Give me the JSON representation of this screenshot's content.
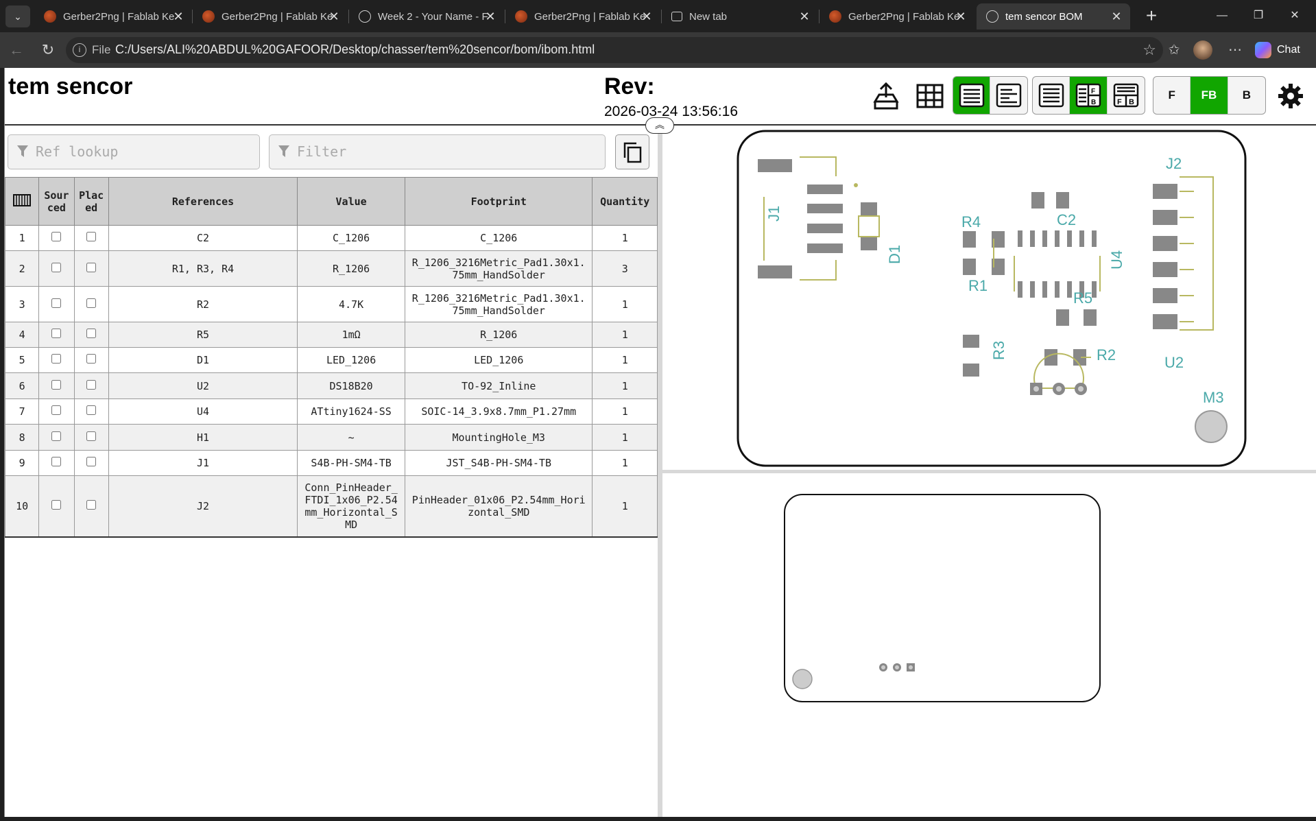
{
  "browser": {
    "tabs": [
      {
        "title": "Gerber2Png | Fablab Ke",
        "icon": "fablab"
      },
      {
        "title": "Gerber2Png | Fablab Ke",
        "icon": "fablab"
      },
      {
        "title": "Week 2 - Your Name - F",
        "icon": "globe"
      },
      {
        "title": "Gerber2Png | Fablab Ke",
        "icon": "fablab"
      },
      {
        "title": "New tab",
        "icon": "newtab"
      },
      {
        "title": "Gerber2Png | Fablab Ke",
        "icon": "fablab"
      },
      {
        "title": "tem sencor BOM",
        "icon": "globe",
        "active": true
      }
    ],
    "address": {
      "scheme_label": "File",
      "url": "C:/Users/ALI%20ABDUL%20GAFOOR/Desktop/chasser/tem%20sencor/bom/ibom.html"
    },
    "chat_label": "Chat"
  },
  "header": {
    "title": "tem sencor",
    "rev_label": "Rev:",
    "date": "2026-03-24 13:56:16",
    "layer_buttons": [
      "F",
      "FB",
      "B"
    ],
    "active_layer": "FB"
  },
  "filters": {
    "ref_placeholder": "Ref lookup",
    "filter_placeholder": "Filter"
  },
  "bom": {
    "columns": [
      "",
      "Sourced",
      "Placed",
      "References",
      "Value",
      "Footprint",
      "Quantity"
    ],
    "column_display": [
      "",
      "Sour ced",
      "Plac ed",
      "References",
      "Value",
      "Footprint",
      "Quantity"
    ],
    "rows": [
      {
        "num": "1",
        "refs": "C2",
        "value": "C_1206",
        "footprint": "C_1206",
        "qty": "1"
      },
      {
        "num": "2",
        "refs": "R1, R3, R4",
        "value": "R_1206",
        "footprint": "R_1206_3216Metric_Pad1.30x1.75mm_HandSolder",
        "qty": "3"
      },
      {
        "num": "3",
        "refs": "R2",
        "value": "4.7K",
        "footprint": "R_1206_3216Metric_Pad1.30x1.75mm_HandSolder",
        "qty": "1"
      },
      {
        "num": "4",
        "refs": "R5",
        "value": "1mΩ",
        "footprint": "R_1206",
        "qty": "1"
      },
      {
        "num": "5",
        "refs": "D1",
        "value": "LED_1206",
        "footprint": "LED_1206",
        "qty": "1"
      },
      {
        "num": "6",
        "refs": "U2",
        "value": "DS18B20",
        "footprint": "TO-92_Inline",
        "qty": "1"
      },
      {
        "num": "7",
        "refs": "U4",
        "value": "ATtiny1624-SS",
        "footprint": "SOIC-14_3.9x8.7mm_P1.27mm",
        "qty": "1"
      },
      {
        "num": "8",
        "refs": "H1",
        "value": "~",
        "footprint": "MountingHole_M3",
        "qty": "1"
      },
      {
        "num": "9",
        "refs": "J1",
        "value": "S4B-PH-SM4-TB",
        "footprint": "JST_S4B-PH-SM4-TB",
        "qty": "1"
      },
      {
        "num": "10",
        "refs": "J2",
        "value": "Conn_PinHeader_FTDI_1x06_P2.54mm_Horizontal_SMD",
        "footprint": "PinHeader_01x06_P2.54mm_Horizontal_SMD",
        "qty": "1"
      }
    ]
  },
  "pcb_labels": {
    "J1": "J1",
    "D1": "D1",
    "R4": "R4",
    "R1": "R1",
    "C2": "C2",
    "R5": "R5",
    "U4": "U4",
    "J2": "J2",
    "R3": "R3",
    "R2": "R2",
    "U2": "U2",
    "M3": "M3"
  },
  "colors": {
    "accent_green": "#11a600",
    "silkscreen_teal": "#4aa9a9",
    "pad_gray": "#888888",
    "outline_olive": "#b8b860"
  }
}
